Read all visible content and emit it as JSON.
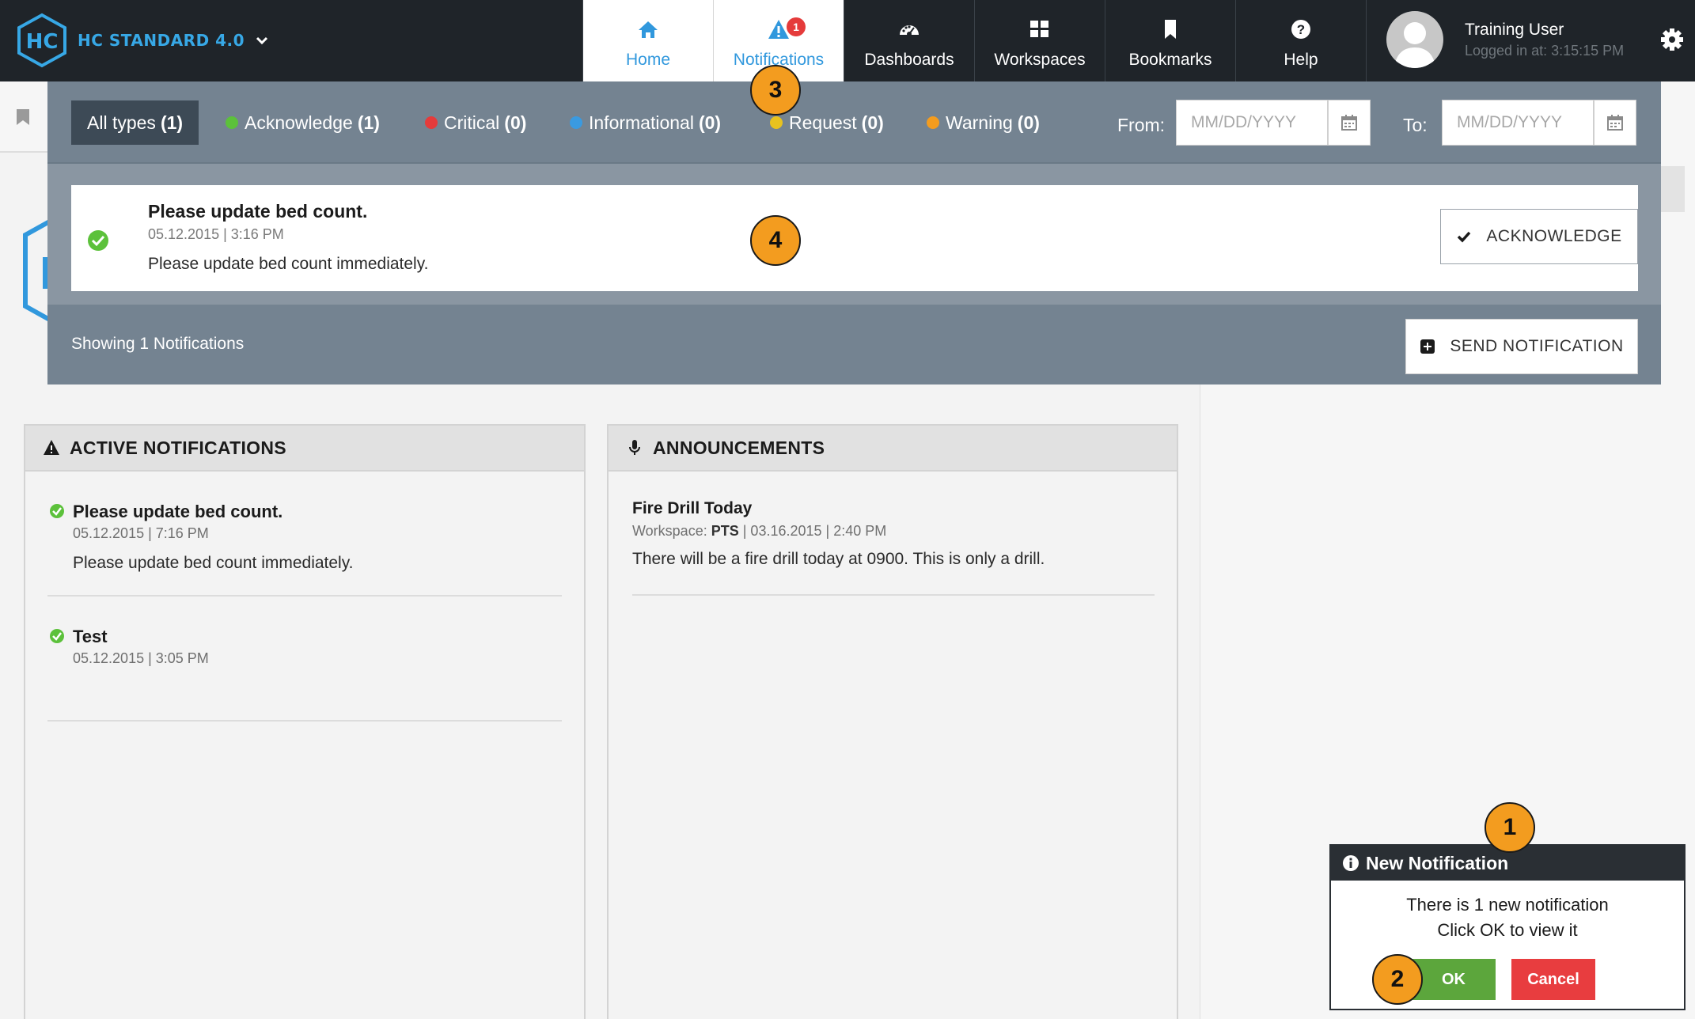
{
  "brand": {
    "name": "HC STANDARD 4.0",
    "logo_text": "HC"
  },
  "nav": [
    {
      "label": "Home",
      "icon": "home-icon"
    },
    {
      "label": "Notifications",
      "icon": "alert-icon",
      "badge": "1"
    },
    {
      "label": "Dashboards",
      "icon": "dashboard-icon"
    },
    {
      "label": "Workspaces",
      "icon": "workspaces-icon"
    },
    {
      "label": "Bookmarks",
      "icon": "bookmark-icon"
    },
    {
      "label": "Help",
      "icon": "help-icon"
    }
  ],
  "user": {
    "name": "Training User",
    "login": "Logged in at: 3:15:15 PM"
  },
  "notifications_panel": {
    "filters": [
      {
        "label": "All types",
        "count": "(1)",
        "color": ""
      },
      {
        "label": "Acknowledge",
        "count": "(1)",
        "color": "#5cc13b"
      },
      {
        "label": "Critical",
        "count": "(0)",
        "color": "#e53b3b"
      },
      {
        "label": "Informational",
        "count": "(0)",
        "color": "#3a9ae0"
      },
      {
        "label": "Request",
        "count": "(0)",
        "color": "#e8c21f"
      },
      {
        "label": "Warning",
        "count": "(0)",
        "color": "#f39c1f"
      }
    ],
    "from_label": "From:",
    "to_label": "To:",
    "date_placeholder": "MM/DD/YYYY",
    "item": {
      "title": "Please update bed count.",
      "meta": "05.12.2015 | 3:16 PM",
      "body": "Please update bed count immediately.",
      "action": "ACKNOWLEDGE"
    },
    "count_text": "Showing 1 Notifications",
    "send_button": "SEND NOTIFICATION"
  },
  "active_notifications": {
    "title": "ACTIVE NOTIFICATIONS",
    "items": [
      {
        "title": "Please update bed count.",
        "meta": "05.12.2015 | 7:16 PM",
        "body": "Please update bed count immediately."
      },
      {
        "title": "Test",
        "meta": "05.12.2015 | 3:05 PM",
        "body": ""
      }
    ]
  },
  "announcements": {
    "title": "ANNOUNCEMENTS",
    "items": [
      {
        "title": "Fire Drill Today",
        "meta_prefix": "Workspace:",
        "workspace": "PTS",
        "meta_suffix": "| 03.16.2015 | 2:40 PM",
        "body": "There will be a fire drill today at 0900. This is only a drill."
      }
    ]
  },
  "toast": {
    "title": "New Notification",
    "line1": "There is 1 new notification",
    "line2": "Click OK to view it",
    "ok": "OK",
    "cancel": "Cancel"
  },
  "callouts": [
    "1",
    "2",
    "3",
    "4"
  ]
}
